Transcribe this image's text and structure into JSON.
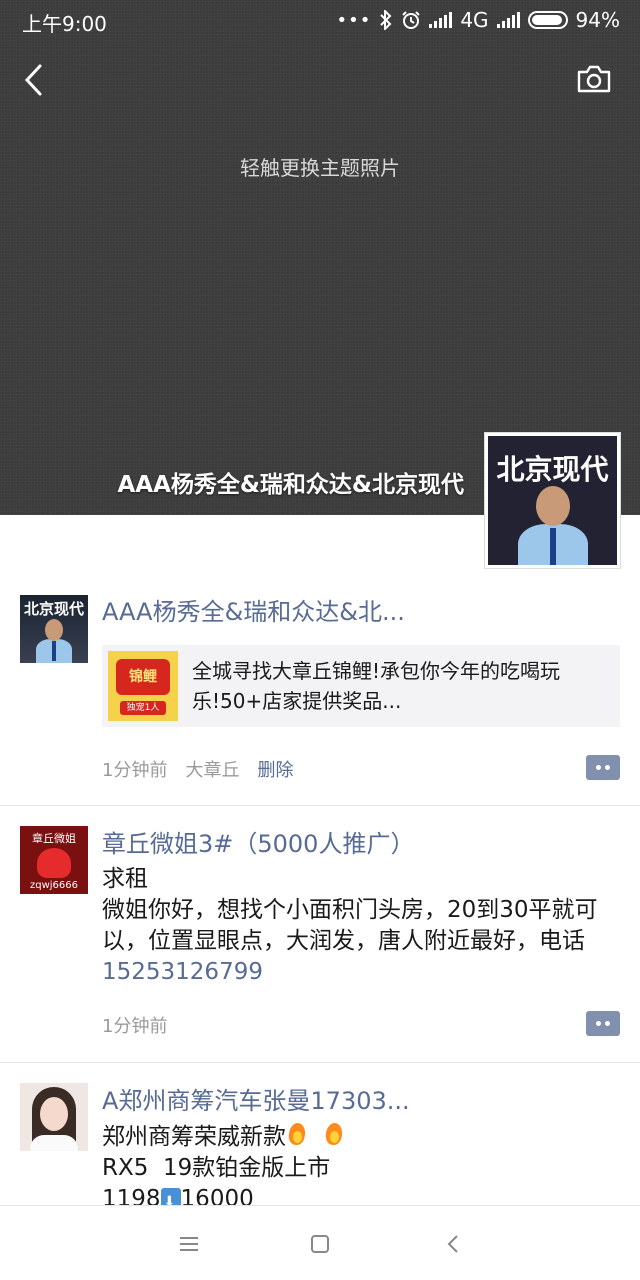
{
  "status_bar": {
    "time": "上午9:00",
    "network": "4G",
    "battery": "94%",
    "battery_level": 0.94
  },
  "cover": {
    "hint": "轻触更换主题照片",
    "profile_name": "AAA杨秀全&瑞和众达&北京现代",
    "avatar_brand": "北京现代"
  },
  "posts": [
    {
      "name": "AAA杨秀全&瑞和众达&北...",
      "avatar_brand": "北京现代",
      "share": {
        "text": "全城寻找大章丘锦鲤!承包你今年的吃喝玩乐!50+店家提供奖品...",
        "thumb_top": "锦鲤",
        "thumb_tag": "独宠1人"
      },
      "time": "1分钟前",
      "location": "大章丘",
      "delete": "删除"
    },
    {
      "name": "章丘微姐3#（5000人推广）",
      "avatar_top": "章丘微姐",
      "avatar_bottom": "zqwj6666",
      "text_line1": "求租",
      "text_body": "微姐你好，想找个小面积门头房，20到30平就可以，位置显眼点，大润发，唐人附近最好，电话",
      "phone": "15253126799",
      "time": "1分钟前"
    },
    {
      "name": "A郑州商筹汽车张曼17303...",
      "text_line1": "郑州商筹荣威新款",
      "text_line2": "RX5  19款铂金版上市",
      "text_line3_a": "1198",
      "text_line3_b": "16000"
    }
  ],
  "colors": {
    "link": "#576b95",
    "cover_bg": "#3d3d3d",
    "meta": "#9a9a9a"
  },
  "icons": {
    "back": "back-arrow-icon",
    "camera": "camera-icon",
    "more": "comment-more-icon",
    "nav_menu": "menu-icon",
    "nav_home": "home-square-icon",
    "nav_back": "back-triangle-icon"
  }
}
